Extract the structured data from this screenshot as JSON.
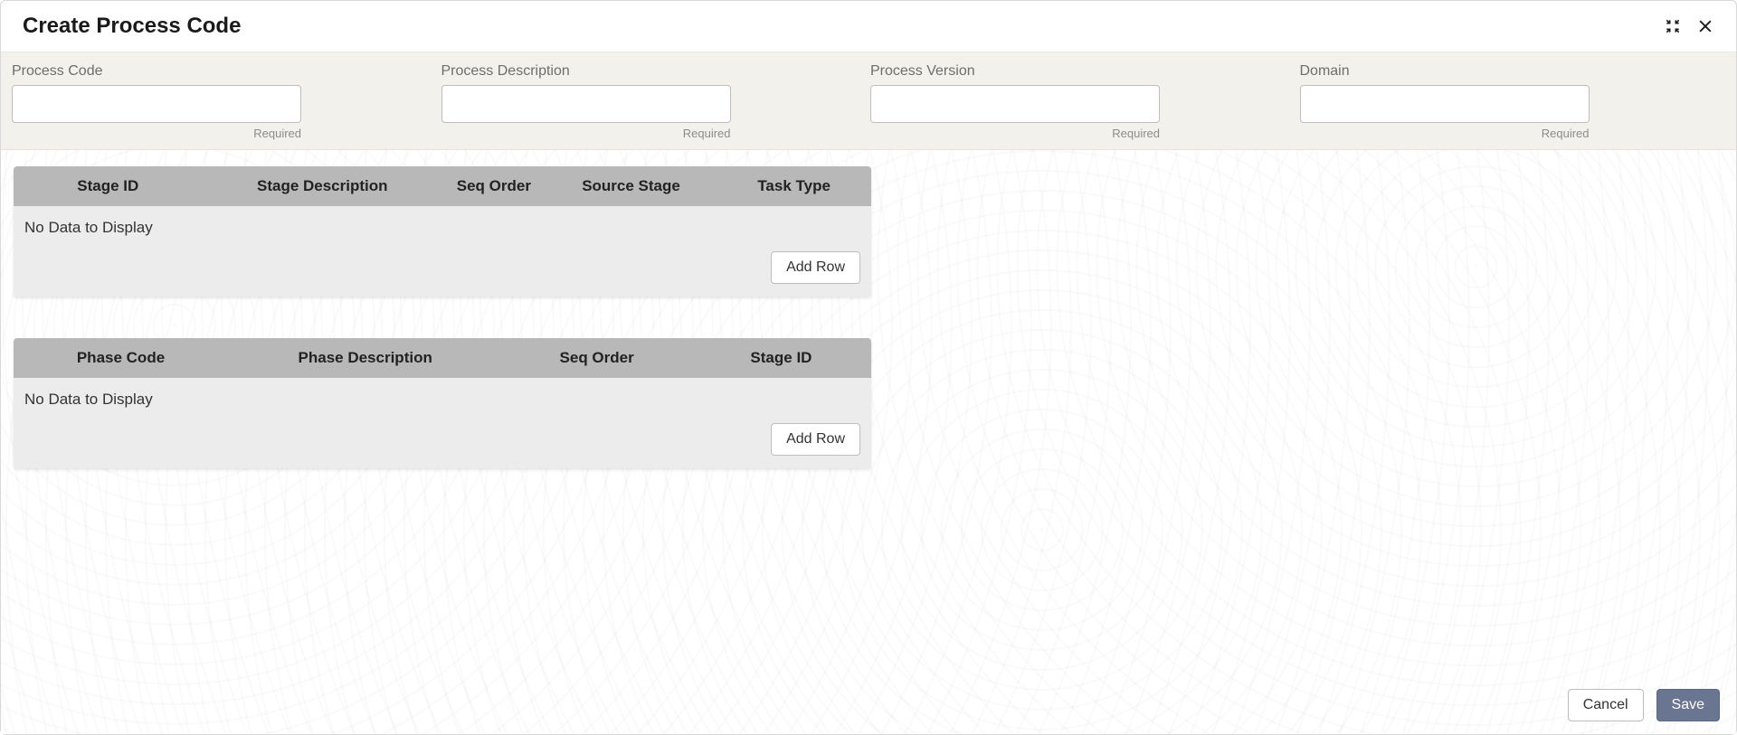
{
  "header": {
    "title": "Create Process Code"
  },
  "form": {
    "processCode": {
      "label": "Process Code",
      "value": "",
      "hint": "Required"
    },
    "processDescription": {
      "label": "Process Description",
      "value": "",
      "hint": "Required"
    },
    "processVersion": {
      "label": "Process Version",
      "value": "",
      "hint": "Required"
    },
    "domain": {
      "label": "Domain",
      "value": "",
      "hint": "Required"
    }
  },
  "tables": {
    "stages": {
      "columns": [
        "Stage ID",
        "Stage Description",
        "Seq Order",
        "Source Stage",
        "Task Type"
      ],
      "emptyText": "No Data to Display",
      "addRowLabel": "Add Row"
    },
    "phases": {
      "columns": [
        "Phase Code",
        "Phase Description",
        "Seq Order",
        "Stage ID"
      ],
      "emptyText": "No Data to Display",
      "addRowLabel": "Add Row"
    }
  },
  "footer": {
    "cancel": "Cancel",
    "save": "Save"
  }
}
